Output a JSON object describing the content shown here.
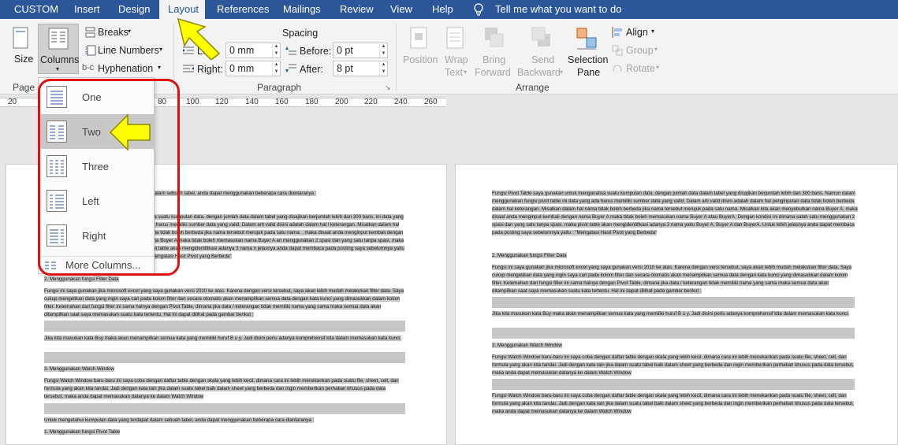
{
  "tabs": [
    "CUSTOM",
    "Insert",
    "Design",
    "Layout",
    "References",
    "Mailings",
    "Review",
    "View",
    "Help"
  ],
  "active_tab": "Layout",
  "tell_me": "Tell me what you want to do",
  "ribbon": {
    "page_setup": {
      "size": "Size",
      "columns": "Columns",
      "breaks": "Breaks",
      "line_numbers": "Line Numbers",
      "hyphenation": "Hyphenation",
      "group_label": "Page"
    },
    "paragraph": {
      "spacing_header": "Spacing",
      "left_label": "Left:",
      "left_value": "0 mm",
      "right_label": "Right:",
      "right_value": "0 mm",
      "before_label": "Before:",
      "before_value": "0 pt",
      "after_label": "After:",
      "after_value": "8 pt",
      "group_label": "Paragraph"
    },
    "arrange": {
      "position": "Position",
      "wrap_text_1": "Wrap",
      "wrap_text_2": "Text",
      "bring_forward_1": "Bring",
      "bring_forward_2": "Forward",
      "send_backward_1": "Send",
      "send_backward_2": "Backward",
      "selection_pane_1": "Selection",
      "selection_pane_2": "Pane",
      "align": "Align",
      "group": "Group",
      "rotate": "Rotate",
      "group_label": "Arrange"
    }
  },
  "ruler_numbers": [
    "20",
    "80",
    "100",
    "120",
    "140",
    "160",
    "180",
    "200",
    "220",
    "240",
    "260"
  ],
  "columns_menu": {
    "items": [
      "One",
      "Two",
      "Three",
      "Left",
      "Right"
    ],
    "hovered": "Two",
    "more": "More Columns..."
  },
  "page1": {
    "p1": "at dalam sebuah tabel, anda dapat menggunakan beberapa cara diantaranya :",
    "p2": "alisa suatu kumpulan data, dengan jumlah data dalam tabel yang disajikan berjumlah lebih dari 300 baris. ini data yang ada harus memiliki sumber data yang valid. Dalam arti valid disini adalah dalam hal l keterangan. Misalkan dalam hal nama tidak boleh berbeda jika nama tersebut merujuk pada satu nama. , maka disaat anda menginput kembali dengan nama Buyer A maka tidak boleh memasukan nama Buyer A an menggunakan 2 spasi dan yang satu tanpa spasi, maka pivot table akan mengidentifikasi adanya 3 nama n jelasnya anda dapat membaca pada posting saya sebelumnya yaitu : \"Mengatasi Hasil Pivot yang Berbeda\"",
    "h2": "2. Menggunakan fungsi Filter Data",
    "p3": "Fungsi ini saya gunakan jika microsoft excel yang saya gunakan versi 2010 ke atas. Karena dengan versi tersebut, saya akan lebih mudah melakukan filter data. Saya cukup mengetikan data yang ingin saya cari pada kolom filter dan secara otomatis akan menampilkan semua data dengan kata kunci yang dimasukkan dalam kolom filter. Kelemahan dari fungsi filter ini sama halnya dengan Pivot Table, dimana jika data / keterangan tidak memiliki nama yang sama maka semua data akan ditampilkan saat saya memasukan suatu kata tertentu. Hal ini dapat dilihat pada gambar berikut :",
    "p4": "Jika kita masukan kata Buy maka akan menampilkan semua kata yang memiliki huruf B u y. Jadi disini perlu adanya komprehensif kita dalam memasukan kata kunci.",
    "h3": "3. Menggunakan Watch Window",
    "p5": "Fungsi Watch Window baru-baru ini saya coba dengan daftar table dengan skala yang lebih kecil, dimana cara ini lebih menekankan pada suatu file, sheet, cell, dan formula yang akan kita tandai. Jadi dengan kata lain jika dalam suatu tabel baik dalam sheet yang berbeda dan ingin memberikan perhatian khusus pada data tersebut, maka anda dapat memasukan datanya ke dalam Watch Window",
    "p6": "Untuk mengetahui kumpulan data yang terdapat dalam sebuah tabel, anda dapat menggunakan beberapa cara diantaranya :",
    "h4": "1. Menggunakan fungsi Pivot Table"
  },
  "page2": {
    "p1": "Fungsi Pivot Table saya gunakan untuk menganalisa suatu kumpulan data, dengan jumlah data dalam tabel yang disajikan berjumlah lebih dari 300 baris. Namun dalam menggunakan fungsi pivot table ini data yang ada harus memiliki sumber data yang valid. Dalam arti valid disini adalah dalam hal penginputan data tidak boleh berbeda dalam hal keterangan. Misalkan dalam hal nama tidak boleh berbeda jika nama tersebut merujuk pada satu nama. Misalkan kita akan menyebutkan nama Buyer A, maka disaat anda menginput kembali dengan nama Buyer A maka tidak boleh memasukan nama Buyer A atau BuyerA. Dengan kondisi ini dimana salah satu menggunakan 2 spasi dan yang satu tanpa spasi, maka pivot table akan mengidentifikasi adanya 3 nama yaitu Buyer A, Buyer A dan BuyerA. Untuk lebih jelasnya anda dapat membaca pada posting saya sebelumnya yaitu : \"Mengatasi Hasil Pivot yang Berbeda\"",
    "h2": "2. Menggunakan fungsi Filter Data",
    "p2": "Fungsi ini saya gunakan jika microsoft excel yang saya gunakan versi 2010 ke atas. Karena dengan versi tersebut, saya akan lebih mudah melakukan filter data. Saya cukup mengetikan data yang ingin saya cari pada kolom filter dan secara otomatis akan menampilkan semua data dengan kata kunci yang dimasukkan dalam kolom filter. Kelemahan dari fungsi filter ini sama halnya dengan Pivot Table, dimana jika data / keterangan tidak memiliki nama yang sama maka semua data akan ditampilkan saat saya memasukan suatu kata tertentu. Hal ini dapat dilihat pada gambar berikut :",
    "p3": "Jika kita masukan kata Buy maka akan menampilkan semua kata yang memiliki huruf B u y. Jadi disini perlu adanya komprehensif kita dalam memasukan kata kunci.",
    "h3": "3. Menggunakan Watch Window",
    "p4": "Fungsi Watch Window baru-baru ini saya coba dengan daftar table dengan skala yang lebih kecil, dimana cara ini lebih menekankan pada suatu file, sheet, cell, dan formula yang akan kita tandai. Jadi dengan kata lain jika dalam suatu tabel baik dalam sheet yang berbeda dan ingin memberikan perhatian khusus pada data tersebut, maka anda dapat memasukan datanya ke dalam Watch Window",
    "p5": "Fungsi Watch Window baru-baru ini saya coba dengan daftar table dengan skala yang lebih kecil, dimana cara ini lebih menekankan pada suatu file, sheet, cell, dan formula yang akan kita tandai. Jadi dengan kata lain jika dalam suatu tabel baik dalam sheet yang berbeda dan ingin memberikan perhatian khusus pada data tersebut, maka anda dapat memasukan datanya ke dalam Watch Window"
  },
  "colors": {
    "tabbar": "#2b579a",
    "ribbon": "#f3f3f3",
    "highlight": "#c6c6c6",
    "annotation_red": "#e01010",
    "annotation_yellow": "#ffff00"
  }
}
